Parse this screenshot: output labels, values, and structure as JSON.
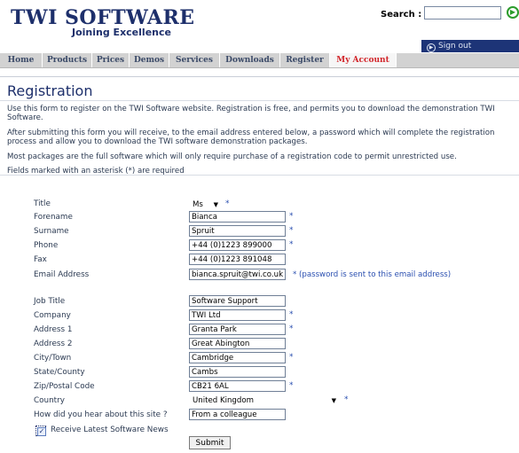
{
  "header": {
    "logo_main": "TWI SOFTWARE",
    "logo_sub": "Joining Excellence",
    "search_label": "Search :",
    "search_value": "",
    "search_go_icon": "arrow-right-circle-icon",
    "signout_label": "Sign out"
  },
  "nav": {
    "items": [
      {
        "label": "Home"
      },
      {
        "label": "Products"
      },
      {
        "label": "Prices"
      },
      {
        "label": "Demos"
      },
      {
        "label": "Services"
      },
      {
        "label": "Downloads"
      },
      {
        "label": "Register"
      },
      {
        "label": "My Account"
      }
    ],
    "active_color": "#d2252a"
  },
  "page": {
    "title": "Registration",
    "intro_1a": "Use this form to register on the TWI Software website. Registration is free, and permits you to download the demonstration TWI",
    "intro_1b": "Software.",
    "intro_2a": "After submitting this form you will receive, to the email address entered below, a password which will complete the registration",
    "intro_2b": "process and allow you to download the TWI software demonstration packages.",
    "intro_3": "Most packages are the full software which will only require purchase of a registration code to permit unrestricted use.",
    "required_note": "Fields marked with an asterisk (*) are required"
  },
  "form": {
    "asterisk": "*",
    "title_label": "Title",
    "title_value": "Ms",
    "forename_label": "Forename",
    "forename_value": "Bianca",
    "surname_label": "Surname",
    "surname_value": "Spruit",
    "phone_label": "Phone",
    "phone_value": "+44 (0)1223 899000",
    "fax_label": "Fax",
    "fax_value": "+44 (0)1223 891048",
    "email_label": "Email Address",
    "email_value": "bianca.spruit@twi.co.uk",
    "email_note": "* (password is sent to this email address)",
    "jobtitle_label": "Job Title",
    "jobtitle_value": "Software Support",
    "company_label": "Company",
    "company_value": "TWI Ltd",
    "address1_label": "Address 1",
    "address1_value": "Granta Park",
    "address2_label": "Address 2",
    "address2_value": "Great Abington",
    "city_label": "City/Town",
    "city_value": "Cambridge",
    "state_label": "State/County",
    "state_value": "Cambs",
    "zip_label": "Zip/Postal Code",
    "zip_value": "CB21 6AL",
    "country_label": "Country",
    "country_value": "United Kingdom",
    "hear_label": "How did you hear about this site ?",
    "hear_value": "From a colleague",
    "news_label": "Receive Latest Software News",
    "news_checked": true,
    "submit_label": "Submit"
  }
}
